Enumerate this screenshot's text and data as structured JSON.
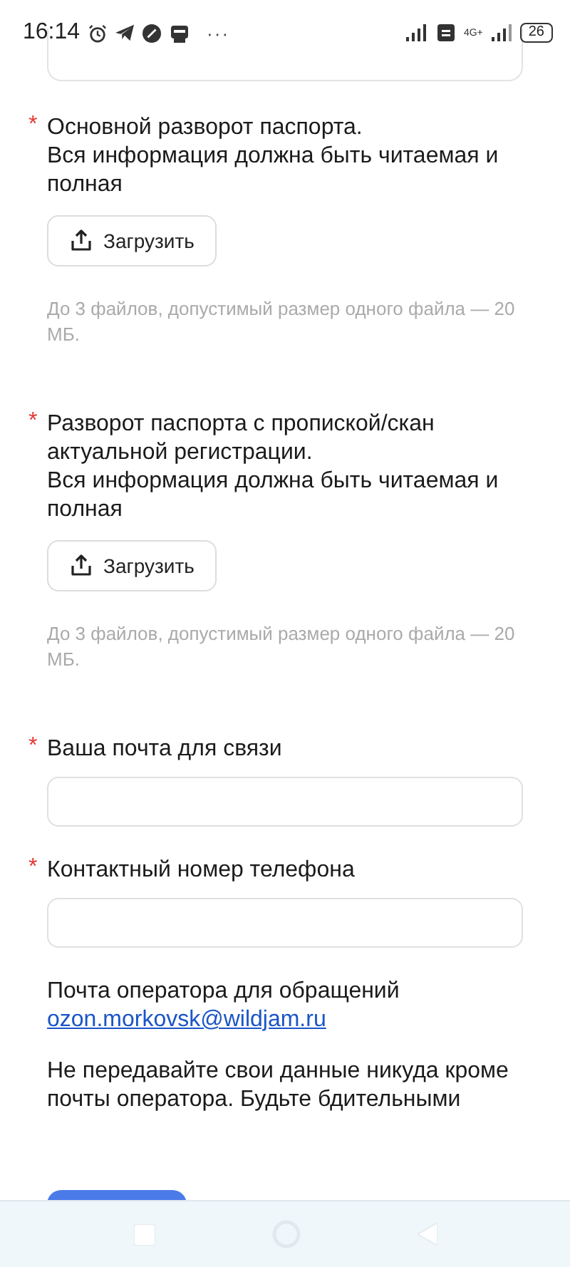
{
  "status_bar": {
    "time": "16:14",
    "more": "···",
    "network": "4G+",
    "battery": "26"
  },
  "sections": [
    {
      "kind": "upload",
      "mark": "*",
      "label": "Основной разворот паспорта.\nВся информация должна быть читаемая и полная",
      "button": "Загрузить",
      "hint": "До 3 файлов, допустимый размер одного файла — 20 МБ."
    },
    {
      "kind": "upload",
      "mark": "*",
      "label": "Разворот паспорта с пропиской/скан актуальной регистрации.\nВся информация должна быть читаемая и полная",
      "button": "Загрузить",
      "hint": "До 3 файлов, допустимый размер одного файла — 20 МБ."
    },
    {
      "kind": "field",
      "mark": "*",
      "label": "Ваша почта для связи"
    },
    {
      "kind": "field",
      "mark": "*",
      "label": "Контактный номер телефона"
    }
  ],
  "info": {
    "text": "Почта оператора для обращений",
    "link": "ozon.morkovsk@wildjam.ru"
  },
  "warning": "Не передавайте свои данные никуда кроме почты оператора. Будьте бдительными"
}
